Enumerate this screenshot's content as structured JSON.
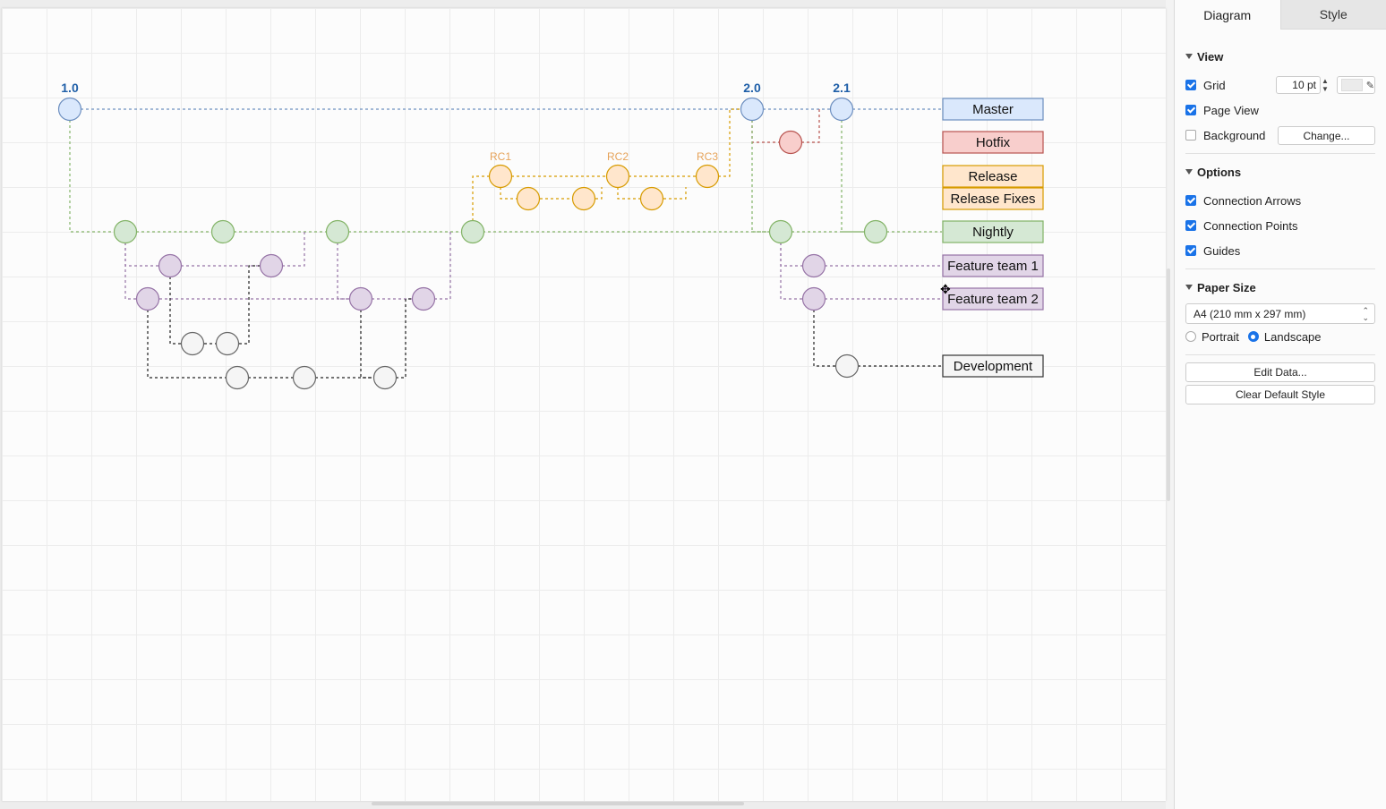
{
  "diagram": {
    "versions": [
      "1.0",
      "2.0",
      "2.1"
    ],
    "rc_labels": [
      "RC1",
      "RC2",
      "RC3"
    ],
    "branches": [
      "Master",
      "Hotfix",
      "Release",
      "Release Fixes",
      "Nightly",
      "Feature team 1",
      "Feature team 2",
      "Development"
    ],
    "colors": {
      "master": "#dae8fc",
      "master_stroke": "#6c8ebf",
      "hotfix": "#f8cecc",
      "hotfix_stroke": "#b85450",
      "release": "#ffe6cc",
      "release_stroke": "#d79b00",
      "nightly": "#d5e8d4",
      "nightly_stroke": "#82b366",
      "feature": "#e1d5e7",
      "feature_stroke": "#9673a6",
      "dev": "#f5f5f5",
      "dev_stroke": "#666666",
      "version_label": "#1f5fa8",
      "rc_label": "#e6a35a"
    }
  },
  "panel": {
    "tabs": {
      "diagram": "Diagram",
      "style": "Style"
    },
    "view": {
      "title": "View",
      "grid_label": "Grid",
      "grid_checked": true,
      "grid_size": "10 pt",
      "page_view_label": "Page View",
      "page_view_checked": true,
      "background_label": "Background",
      "background_checked": false,
      "change_label": "Change..."
    },
    "options": {
      "title": "Options",
      "connection_arrows": "Connection Arrows",
      "connection_points": "Connection Points",
      "guides": "Guides"
    },
    "paper": {
      "title": "Paper Size",
      "size": "A4 (210 mm x 297 mm)",
      "portrait": "Portrait",
      "landscape": "Landscape",
      "orientation": "landscape"
    },
    "buttons": {
      "edit_data": "Edit Data...",
      "clear_style": "Clear Default Style"
    }
  }
}
